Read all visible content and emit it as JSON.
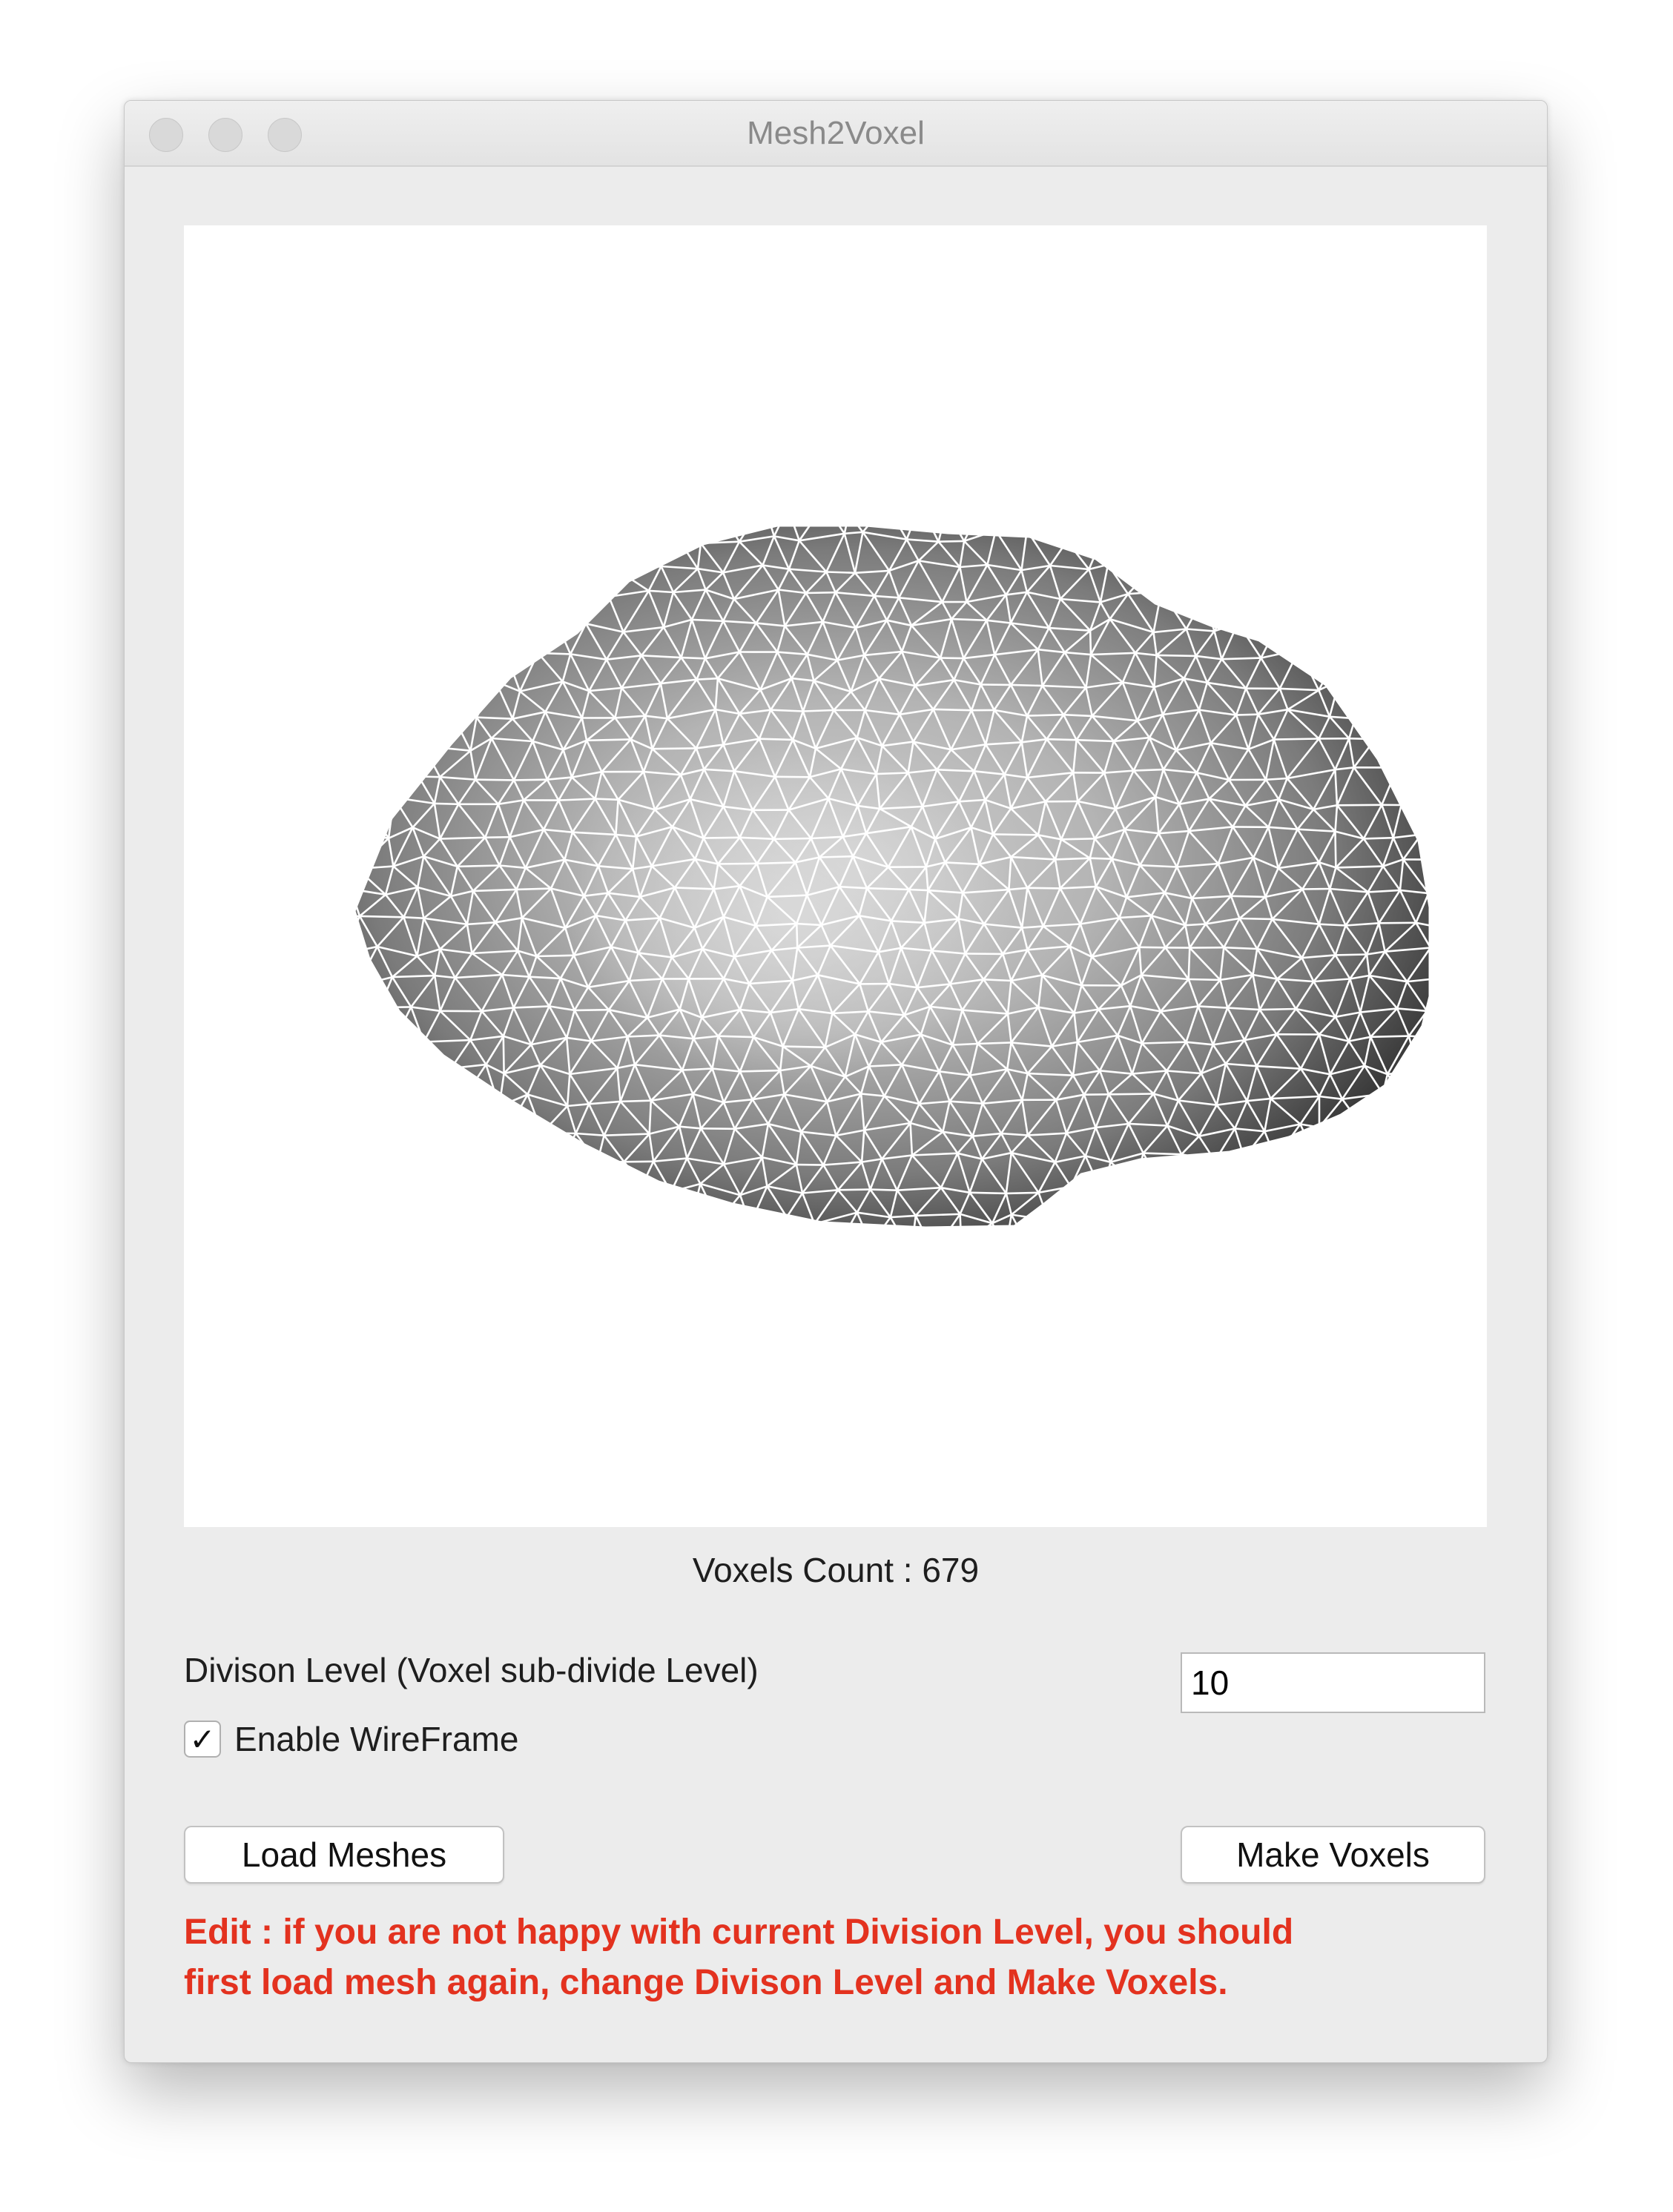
{
  "window": {
    "title": "Mesh2Voxel",
    "traffic_lights": [
      "close",
      "minimize",
      "zoom"
    ]
  },
  "viewport": {
    "content": "wireframe-mesh",
    "background_color": "#ffffff",
    "wire_color": "#ffffff"
  },
  "status": {
    "voxels_count": "Voxels Count : 679"
  },
  "division": {
    "label": "Divison Level (Voxel sub-divide Level)",
    "value": "10"
  },
  "wireframe": {
    "label": "Enable WireFrame",
    "checked": true,
    "check_glyph": "✓"
  },
  "buttons": {
    "load_label": "Load Meshes",
    "make_label": "Make Voxels"
  },
  "note": {
    "line1": "Edit : if you are not happy with current Division Level, you should",
    "line2": "first load mesh again, change Divison Level and Make Voxels.",
    "color": "#e3321f"
  }
}
